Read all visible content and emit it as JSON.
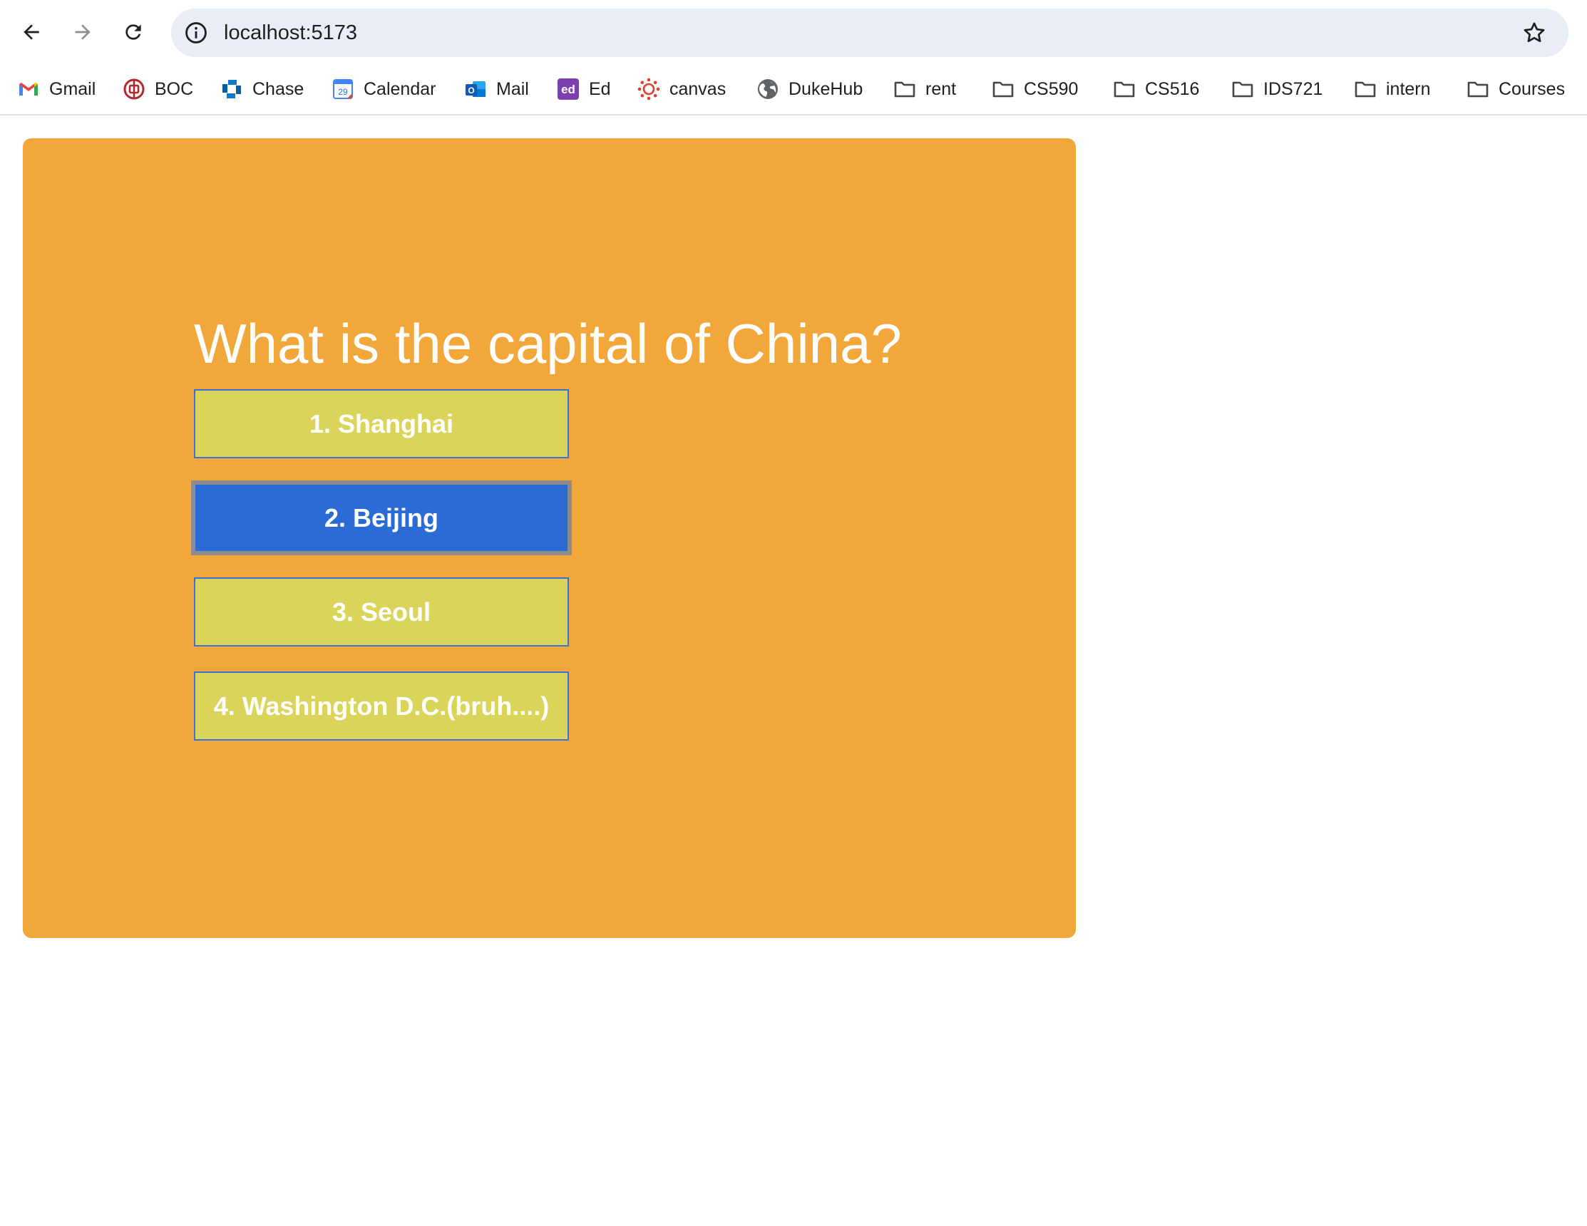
{
  "browser": {
    "url": "localhost:5173",
    "bookmarks": [
      {
        "label": "Gmail",
        "icon": "gmail-icon"
      },
      {
        "label": "BOC",
        "icon": "boc-icon"
      },
      {
        "label": "Chase",
        "icon": "chase-icon"
      },
      {
        "label": "Calendar",
        "icon": "calendar-icon",
        "icon_text": "29"
      },
      {
        "label": "Mail",
        "icon": "outlook-icon",
        "icon_text": "O"
      },
      {
        "label": "Ed",
        "icon": "ed-icon",
        "icon_text": "ed"
      },
      {
        "label": "canvas",
        "icon": "canvas-icon"
      },
      {
        "label": "DukeHub",
        "icon": "globe-icon"
      },
      {
        "label": "rent",
        "icon": "folder-icon"
      },
      {
        "label": "CS590",
        "icon": "folder-icon"
      },
      {
        "label": "CS516",
        "icon": "folder-icon"
      },
      {
        "label": "IDS721",
        "icon": "folder-icon"
      },
      {
        "label": "intern",
        "icon": "folder-icon"
      },
      {
        "label": "Courses",
        "icon": "folder-icon"
      }
    ]
  },
  "quiz": {
    "question": "What is the capital of China?",
    "answers": [
      {
        "label": "1. Shanghai",
        "selected": false
      },
      {
        "label": "2. Beijing",
        "selected": true
      },
      {
        "label": "3. Seoul",
        "selected": false
      },
      {
        "label": "4. Washington D.C.(bruh....)",
        "selected": false
      }
    ]
  },
  "colors": {
    "card_background": "#f2a73b",
    "answer_background": "#dbd45a",
    "answer_selected_background": "#2a6bd6",
    "answer_border": "#3b72d9",
    "omnibox_background": "#e9eef6"
  }
}
